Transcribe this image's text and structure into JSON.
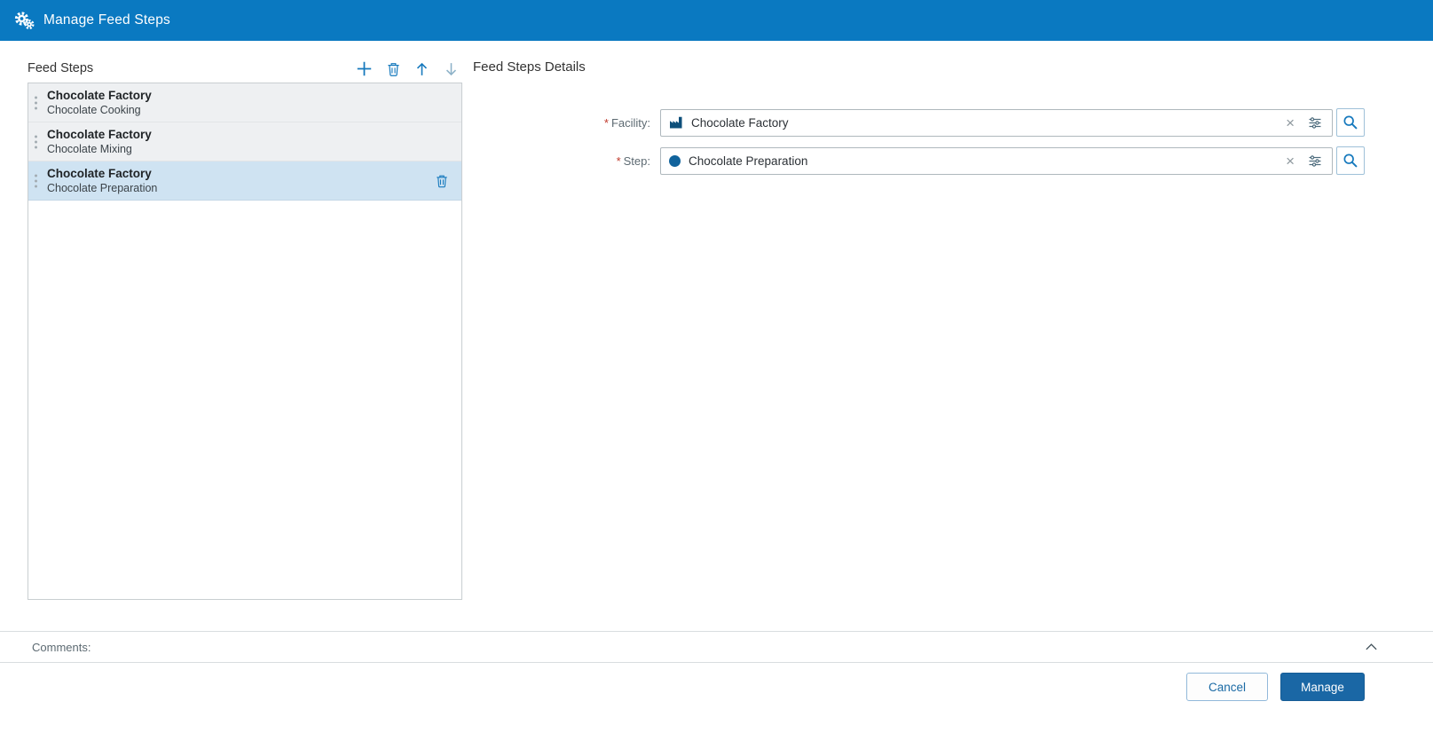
{
  "header": {
    "title": "Manage Feed Steps",
    "icon": "gears-icon",
    "background": "#0a79c1"
  },
  "left_panel": {
    "title": "Feed Steps",
    "toolbar": [
      {
        "name": "add",
        "icon": "plus-icon",
        "enabled": true
      },
      {
        "name": "delete",
        "icon": "trash-icon",
        "enabled": true
      },
      {
        "name": "move-up",
        "icon": "arrow-up-icon",
        "enabled": true
      },
      {
        "name": "move-down",
        "icon": "arrow-down-icon",
        "enabled": false
      }
    ],
    "items": [
      {
        "title": "Chocolate Factory",
        "subtitle": "Chocolate Cooking",
        "selected": false
      },
      {
        "title": "Chocolate Factory",
        "subtitle": "Chocolate Mixing",
        "selected": false
      },
      {
        "title": "Chocolate Factory",
        "subtitle": "Chocolate Preparation",
        "selected": true
      }
    ]
  },
  "details_panel": {
    "title": "Feed Steps Details",
    "required_marker": "*",
    "clear_glyph": "×",
    "fields": [
      {
        "label": "Facility:",
        "required": true,
        "value": "Chocolate Factory",
        "icon": "factory-icon"
      },
      {
        "label": "Step:",
        "required": true,
        "value": "Chocolate Preparation",
        "icon": "circle-icon"
      }
    ]
  },
  "comments": {
    "label": "Comments:",
    "collapse_icon": "chevron-up-icon"
  },
  "footer": {
    "cancel_label": "Cancel",
    "manage_label": "Manage"
  },
  "colors": {
    "header_bg": "#0a79c1",
    "icon_blue": "#1679bd",
    "disabled_icon_blue": "#8fb3c9",
    "selected_item_bg": "#cfe3f2",
    "item_bg": "#eef0f2",
    "primary_button_bg": "#1a67a5",
    "required_red": "#c0392b",
    "facility_icon_color": "#0d4f7a",
    "step_icon_color": "#11639c"
  }
}
